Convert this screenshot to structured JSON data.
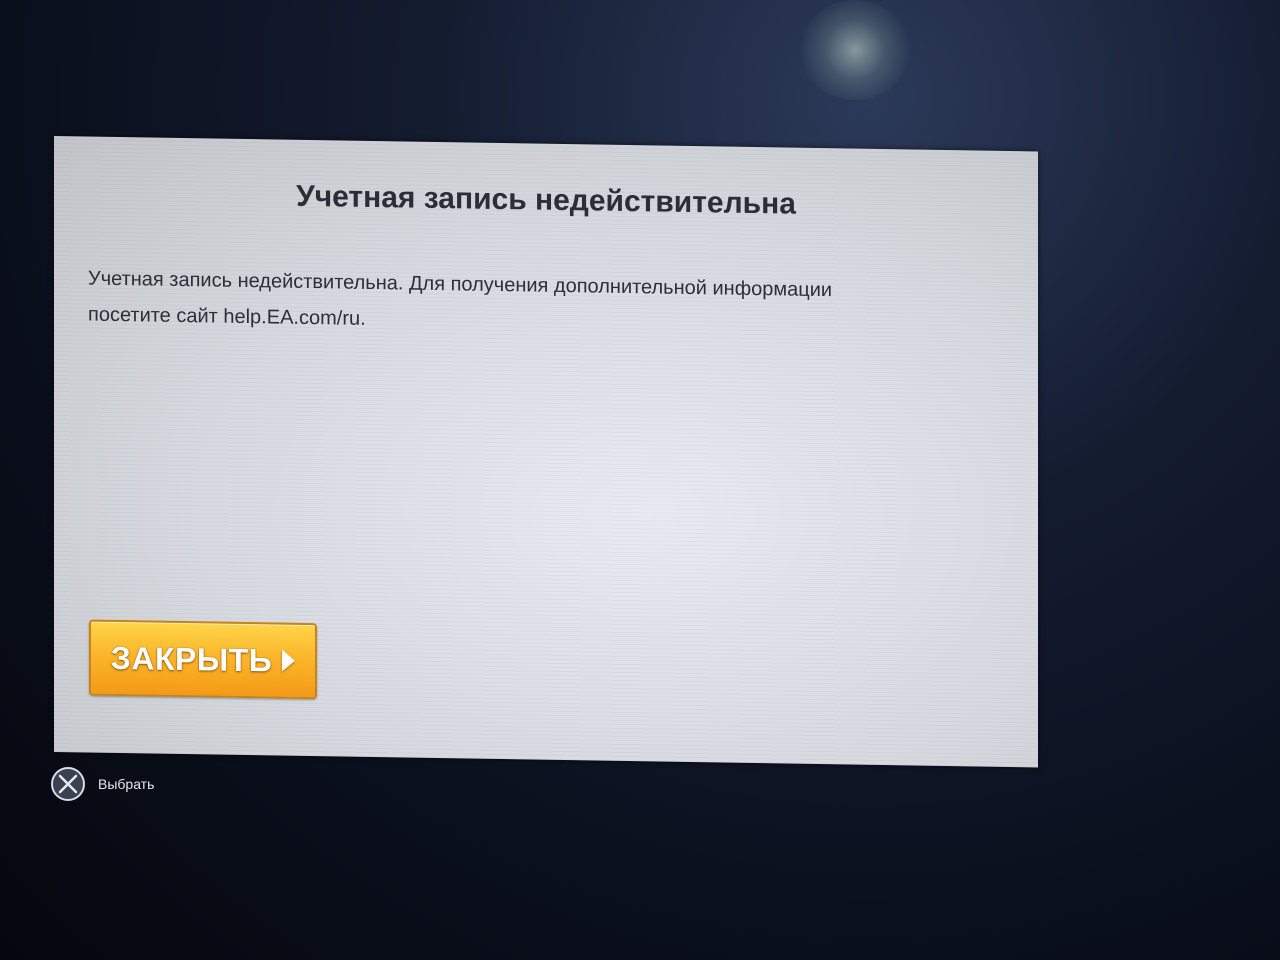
{
  "dialog": {
    "title": "Учетная запись недействительна",
    "message_line1": "Учетная запись недействительна. Для получения дополнительной информации",
    "message_line2": "посетите сайт help.EA.com/ru.",
    "close_label": "ЗАКРЫТЬ",
    "close_icon": "arrow-right-icon",
    "accent_color": "#f7a521"
  },
  "controls_hint": {
    "button_icon": "cross-button-icon",
    "label": "Выбрать"
  }
}
